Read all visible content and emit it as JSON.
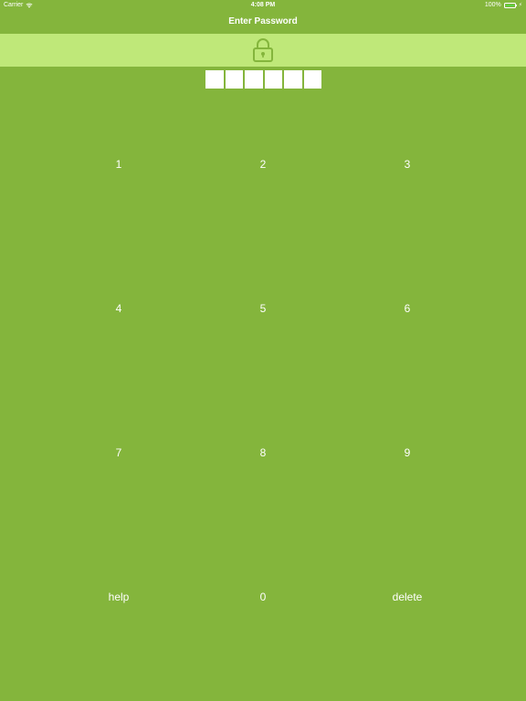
{
  "status_bar": {
    "carrier": "Carrier",
    "time": "4:08 PM",
    "battery_percent": "100%",
    "wifi_icon": "wifi-icon",
    "battery_level": 1.0,
    "battery_color": "#5bd344"
  },
  "header": {
    "title": "Enter Password"
  },
  "lock": {
    "icon": "lock-icon",
    "band_color": "#bfe879",
    "icon_color": "#84b53c"
  },
  "passcode": {
    "length": 6,
    "entered": 0
  },
  "keypad": {
    "keys": [
      "1",
      "2",
      "3",
      "4",
      "5",
      "6",
      "7",
      "8",
      "9",
      "help",
      "0",
      "delete"
    ]
  },
  "colors": {
    "background": "#84b53c",
    "text": "#ffffff"
  }
}
